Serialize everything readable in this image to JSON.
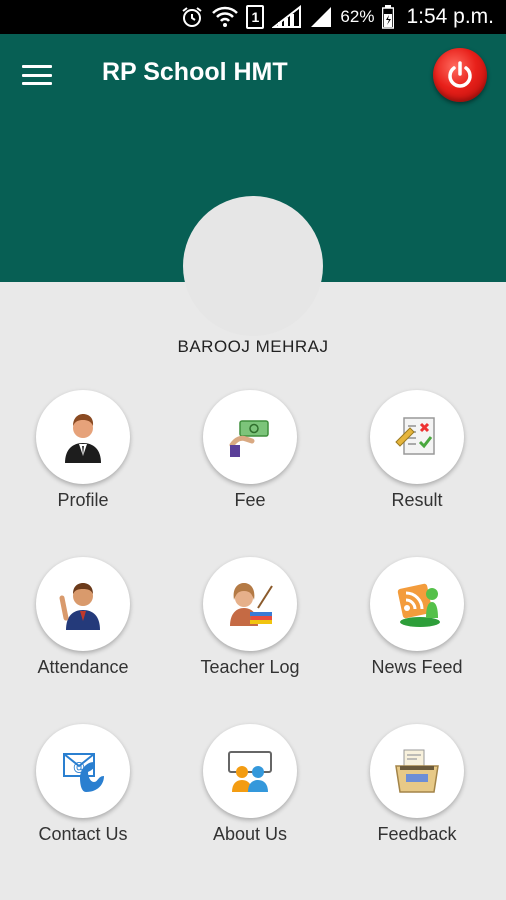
{
  "status_bar": {
    "battery_percent": "62%",
    "time": "1:54 p.m.",
    "sim_label": "1",
    "icons": [
      "alarm-icon",
      "wifi-icon",
      "sim-icon",
      "cell-signal-icon",
      "cell-signal-icon",
      "battery-icon"
    ]
  },
  "app_bar": {
    "title": "RP School HMT",
    "menu_icon": "hamburger-menu-icon",
    "power_icon": "power-icon",
    "color": "#075f54"
  },
  "user": {
    "name": "BAROOJ MEHRAJ"
  },
  "menu": [
    {
      "label": "Profile",
      "icon": "profile-icon"
    },
    {
      "label": "Fee",
      "icon": "fee-icon"
    },
    {
      "label": "Result",
      "icon": "result-icon"
    },
    {
      "label": "Attendance",
      "icon": "attendance-icon"
    },
    {
      "label": "Teacher Log",
      "icon": "teacher-log-icon"
    },
    {
      "label": "News Feed",
      "icon": "news-feed-icon"
    },
    {
      "label": "Contact Us",
      "icon": "contact-us-icon"
    },
    {
      "label": "About Us",
      "icon": "about-us-icon"
    },
    {
      "label": "Feedback",
      "icon": "feedback-icon"
    }
  ]
}
